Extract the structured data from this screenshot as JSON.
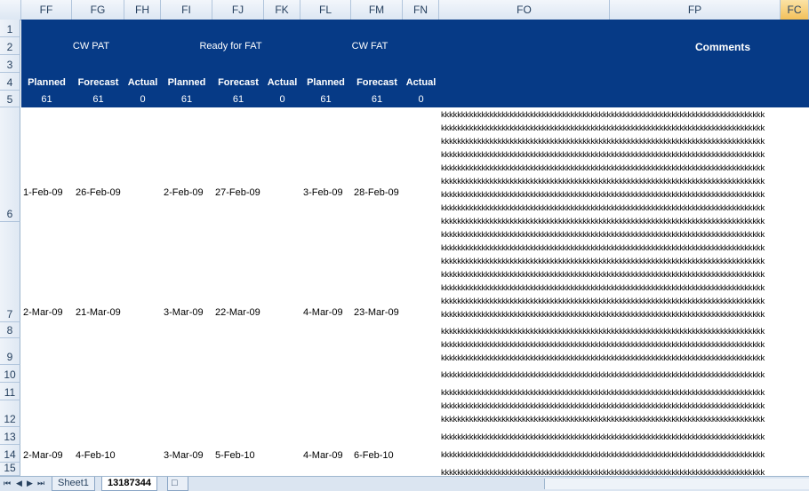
{
  "columns": [
    "FF",
    "FG",
    "FH",
    "FI",
    "FJ",
    "FK",
    "FL",
    "FM",
    "FN",
    "FO",
    "FP",
    "FC"
  ],
  "rows": [
    "1",
    "2",
    "3",
    "4",
    "5",
    "6",
    "7",
    "8",
    "9",
    "10",
    "11",
    "12",
    "13",
    "14",
    "15"
  ],
  "groups": {
    "cw_pat": "CW PAT",
    "ready_fat": "Ready for FAT",
    "cw_fat": "CW FAT",
    "comments": "Comments"
  },
  "subheads": [
    "Planned",
    "Forecast",
    "Actual",
    "Planned",
    "Forecast",
    "Actual",
    "Planned",
    "Forecast",
    "Actual"
  ],
  "counts": [
    "61",
    "61",
    "0",
    "61",
    "61",
    "0",
    "61",
    "61",
    "0"
  ],
  "data_rows": [
    {
      "ff": "1-Feb-09",
      "fg": "26-Feb-09",
      "fi": "2-Feb-09",
      "fj": "27-Feb-09",
      "fl": "3-Feb-09",
      "fm": "28-Feb-09"
    },
    {
      "ff": "2-Mar-09",
      "fg": "21-Mar-09",
      "fi": "3-Mar-09",
      "fj": "22-Mar-09",
      "fl": "4-Mar-09",
      "fm": "23-Mar-09"
    },
    {
      "ff": "2-Mar-09",
      "fg": "4-Feb-10",
      "fi": "3-Mar-09",
      "fj": "5-Feb-10",
      "fl": "4-Mar-09",
      "fm": "6-Feb-10"
    }
  ],
  "comment_text": "kkkkkkkkkkkkkkkkkkkkkkkkkkkkkkkkkkkkkkkkkkkkkkkkkkkkkkkkkkkkkkkkkkkkkkkkkkkkkkkk",
  "sheet_tabs": [
    "Sheet1",
    "13187344"
  ],
  "colors": {
    "header_band": "#063a86",
    "grid_header": "#dde7f3",
    "selected_col": "#f3c05a"
  }
}
